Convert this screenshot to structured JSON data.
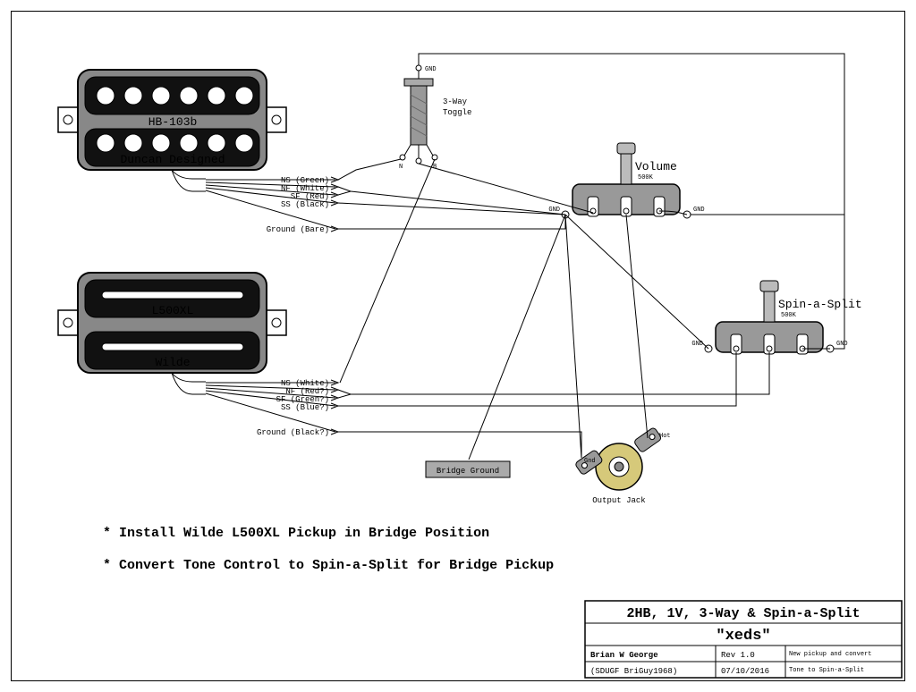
{
  "pickup_top": {
    "model": "HB-103b",
    "brand": "Duncan Designed",
    "wires": {
      "ns": "NS (Green)",
      "nf": "NF (White)",
      "sf": "SF (Red)",
      "ss": "SS (Black)",
      "ground": "Ground (Bare)"
    }
  },
  "pickup_bottom": {
    "model": "L500XL",
    "brand": "Wilde",
    "wires": {
      "ns": "NS (White)",
      "nf": "NF (Red?)",
      "sf": "SF (Green?)",
      "ss": "SS (Blue?)",
      "ground": "Ground (Black?)"
    }
  },
  "toggle": {
    "label": "3-Way\nToggle",
    "gnd": "GND",
    "n": "N",
    "b": "B"
  },
  "volume": {
    "label": "Volume",
    "value": "500K"
  },
  "spin": {
    "label": "Spin-a-Split",
    "value": "500K"
  },
  "bridge_ground": "Bridge Ground",
  "output_jack": {
    "label": "Output Jack",
    "gnd": "Gnd",
    "hot": "Hot"
  },
  "gnd_text": "GND",
  "notes": {
    "line1": "* Install Wilde L500XL Pickup in Bridge Position",
    "line2": "* Convert Tone Control to Spin-a-Split for Bridge Pickup"
  },
  "titleblock": {
    "title": "2HB, 1V, 3-Way & Spin-a-Split",
    "subtitle": "\"xeds\"",
    "author": "Brian W George",
    "author_handle": "(SDUGF BriGuy1968)",
    "rev": "Rev 1.0",
    "date": "07/10/2016",
    "desc1": "New pickup and convert",
    "desc2": "Tone to Spin-a-Split"
  }
}
